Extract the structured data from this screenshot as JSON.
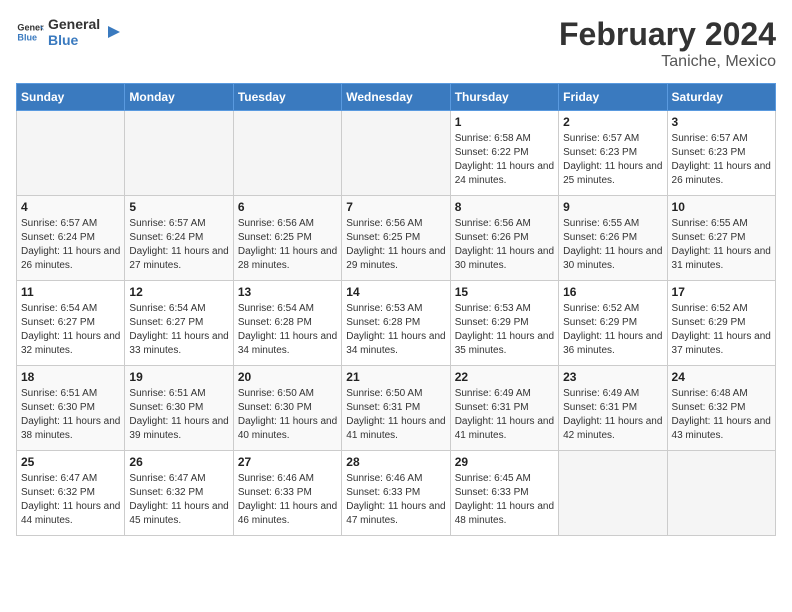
{
  "header": {
    "logo_general": "General",
    "logo_blue": "Blue",
    "title": "February 2024",
    "subtitle": "Taniche, Mexico"
  },
  "days_of_week": [
    "Sunday",
    "Monday",
    "Tuesday",
    "Wednesday",
    "Thursday",
    "Friday",
    "Saturday"
  ],
  "weeks": [
    [
      {
        "day": "",
        "info": ""
      },
      {
        "day": "",
        "info": ""
      },
      {
        "day": "",
        "info": ""
      },
      {
        "day": "",
        "info": ""
      },
      {
        "day": "1",
        "info": "Sunrise: 6:58 AM\nSunset: 6:22 PM\nDaylight: 11 hours and 24 minutes."
      },
      {
        "day": "2",
        "info": "Sunrise: 6:57 AM\nSunset: 6:23 PM\nDaylight: 11 hours and 25 minutes."
      },
      {
        "day": "3",
        "info": "Sunrise: 6:57 AM\nSunset: 6:23 PM\nDaylight: 11 hours and 26 minutes."
      }
    ],
    [
      {
        "day": "4",
        "info": "Sunrise: 6:57 AM\nSunset: 6:24 PM\nDaylight: 11 hours and 26 minutes."
      },
      {
        "day": "5",
        "info": "Sunrise: 6:57 AM\nSunset: 6:24 PM\nDaylight: 11 hours and 27 minutes."
      },
      {
        "day": "6",
        "info": "Sunrise: 6:56 AM\nSunset: 6:25 PM\nDaylight: 11 hours and 28 minutes."
      },
      {
        "day": "7",
        "info": "Sunrise: 6:56 AM\nSunset: 6:25 PM\nDaylight: 11 hours and 29 minutes."
      },
      {
        "day": "8",
        "info": "Sunrise: 6:56 AM\nSunset: 6:26 PM\nDaylight: 11 hours and 30 minutes."
      },
      {
        "day": "9",
        "info": "Sunrise: 6:55 AM\nSunset: 6:26 PM\nDaylight: 11 hours and 30 minutes."
      },
      {
        "day": "10",
        "info": "Sunrise: 6:55 AM\nSunset: 6:27 PM\nDaylight: 11 hours and 31 minutes."
      }
    ],
    [
      {
        "day": "11",
        "info": "Sunrise: 6:54 AM\nSunset: 6:27 PM\nDaylight: 11 hours and 32 minutes."
      },
      {
        "day": "12",
        "info": "Sunrise: 6:54 AM\nSunset: 6:27 PM\nDaylight: 11 hours and 33 minutes."
      },
      {
        "day": "13",
        "info": "Sunrise: 6:54 AM\nSunset: 6:28 PM\nDaylight: 11 hours and 34 minutes."
      },
      {
        "day": "14",
        "info": "Sunrise: 6:53 AM\nSunset: 6:28 PM\nDaylight: 11 hours and 34 minutes."
      },
      {
        "day": "15",
        "info": "Sunrise: 6:53 AM\nSunset: 6:29 PM\nDaylight: 11 hours and 35 minutes."
      },
      {
        "day": "16",
        "info": "Sunrise: 6:52 AM\nSunset: 6:29 PM\nDaylight: 11 hours and 36 minutes."
      },
      {
        "day": "17",
        "info": "Sunrise: 6:52 AM\nSunset: 6:29 PM\nDaylight: 11 hours and 37 minutes."
      }
    ],
    [
      {
        "day": "18",
        "info": "Sunrise: 6:51 AM\nSunset: 6:30 PM\nDaylight: 11 hours and 38 minutes."
      },
      {
        "day": "19",
        "info": "Sunrise: 6:51 AM\nSunset: 6:30 PM\nDaylight: 11 hours and 39 minutes."
      },
      {
        "day": "20",
        "info": "Sunrise: 6:50 AM\nSunset: 6:30 PM\nDaylight: 11 hours and 40 minutes."
      },
      {
        "day": "21",
        "info": "Sunrise: 6:50 AM\nSunset: 6:31 PM\nDaylight: 11 hours and 41 minutes."
      },
      {
        "day": "22",
        "info": "Sunrise: 6:49 AM\nSunset: 6:31 PM\nDaylight: 11 hours and 41 minutes."
      },
      {
        "day": "23",
        "info": "Sunrise: 6:49 AM\nSunset: 6:31 PM\nDaylight: 11 hours and 42 minutes."
      },
      {
        "day": "24",
        "info": "Sunrise: 6:48 AM\nSunset: 6:32 PM\nDaylight: 11 hours and 43 minutes."
      }
    ],
    [
      {
        "day": "25",
        "info": "Sunrise: 6:47 AM\nSunset: 6:32 PM\nDaylight: 11 hours and 44 minutes."
      },
      {
        "day": "26",
        "info": "Sunrise: 6:47 AM\nSunset: 6:32 PM\nDaylight: 11 hours and 45 minutes."
      },
      {
        "day": "27",
        "info": "Sunrise: 6:46 AM\nSunset: 6:33 PM\nDaylight: 11 hours and 46 minutes."
      },
      {
        "day": "28",
        "info": "Sunrise: 6:46 AM\nSunset: 6:33 PM\nDaylight: 11 hours and 47 minutes."
      },
      {
        "day": "29",
        "info": "Sunrise: 6:45 AM\nSunset: 6:33 PM\nDaylight: 11 hours and 48 minutes."
      },
      {
        "day": "",
        "info": ""
      },
      {
        "day": "",
        "info": ""
      }
    ]
  ]
}
